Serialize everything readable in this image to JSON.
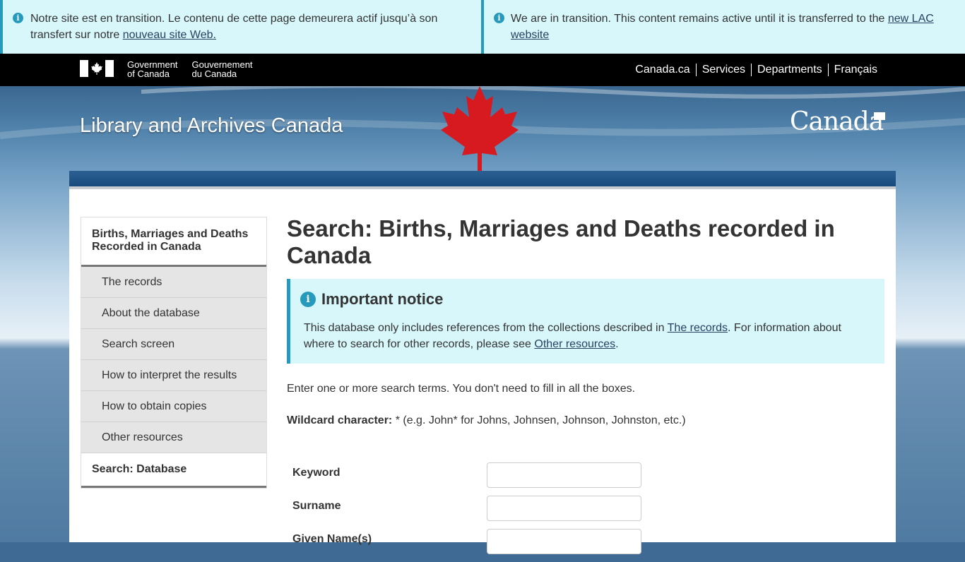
{
  "transition": {
    "fr_text": "Notre site est en transition. Le contenu de cette page demeurera actif jusqu’à son transfert sur notre ",
    "fr_link": "nouveau site Web.",
    "en_text": "We are in transition. This content remains active until it is transferred to the ",
    "en_link": "new LAC website"
  },
  "fip": {
    "gov_en_1": "Government",
    "gov_en_2": "of Canada",
    "gov_fr_1": "Gouvernement",
    "gov_fr_2": "du Canada",
    "nav": [
      "Canada.ca",
      "Services",
      "Departments",
      "Français"
    ]
  },
  "header": {
    "site_title": "Library and Archives Canada",
    "wordmark": "Canada"
  },
  "sidebar": {
    "section_title": "Births, Marriages and Deaths Recorded in Canada",
    "items": [
      "The records",
      "About the database",
      "Search screen",
      "How to interpret the results",
      "How to obtain copies",
      "Other resources"
    ],
    "current": "Search: Database"
  },
  "main": {
    "title": "Search: Births, Marriages and Deaths recorded in Canada",
    "notice": {
      "heading": "Important notice",
      "text_1": "This database only includes references from the collections described in ",
      "link_1": "The records",
      "text_2": ". For information about where to search for other records, please see ",
      "link_2": "Other resources",
      "text_3": "."
    },
    "intro": "Enter one or more search terms. You don't need to fill in all the boxes.",
    "wildcard_label": "Wildcard character:",
    "wildcard_text": " * (e.g. John* for Johns, Johnsen, Johnson, Johnston, etc.)",
    "fields": [
      {
        "label": "Keyword",
        "value": ""
      },
      {
        "label": "Surname",
        "value": ""
      },
      {
        "label": "Given Name(s)",
        "value": ""
      }
    ]
  },
  "colors": {
    "alert_bg": "#d7f7fb",
    "alert_border": "#269abc",
    "fip_bg": "#000000",
    "link": "#284162"
  }
}
